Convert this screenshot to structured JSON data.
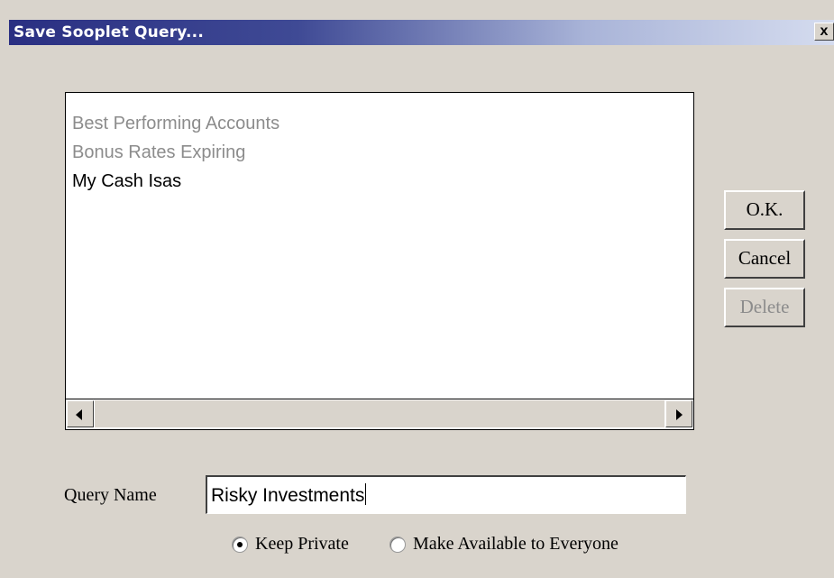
{
  "window": {
    "title": "Save Sooplet Query...",
    "close_label": "x"
  },
  "queries": {
    "items": [
      {
        "label": "Best Performing Accounts",
        "enabled": false
      },
      {
        "label": "Bonus Rates Expiring",
        "enabled": false
      },
      {
        "label": "My Cash Isas",
        "enabled": true
      }
    ]
  },
  "buttons": {
    "ok": "O.K.",
    "cancel": "Cancel",
    "delete": "Delete",
    "delete_enabled": false
  },
  "form": {
    "query_name_label": "Query Name",
    "query_name_value": "Risky Investments"
  },
  "visibility": {
    "options": [
      {
        "label": "Keep Private",
        "selected": true
      },
      {
        "label": "Make Available to Everyone",
        "selected": false
      }
    ]
  },
  "icons": {
    "close": "close-icon",
    "scroll_left": "arrow-left-icon",
    "scroll_right": "arrow-right-icon"
  }
}
